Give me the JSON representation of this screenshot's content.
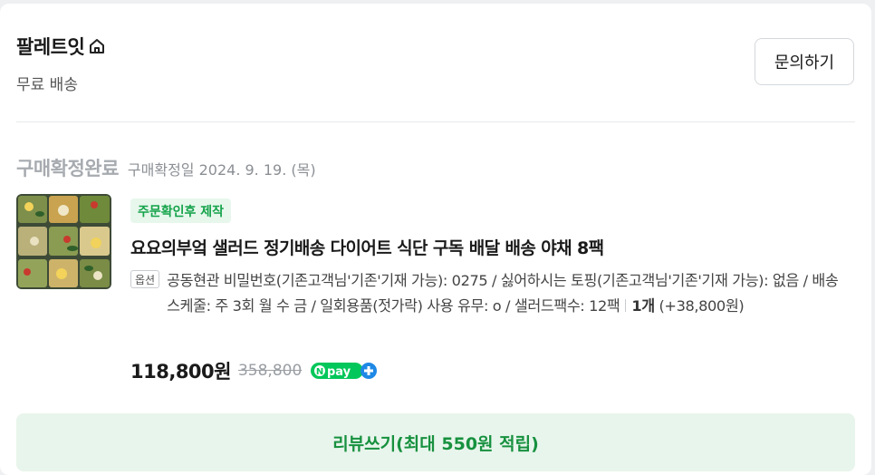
{
  "store": {
    "name": "팔레트잇",
    "shipping": "무료 배송",
    "inquiry_label": "문의하기"
  },
  "order": {
    "status": "구매확정완료",
    "confirm_date": "구매확정일 2024. 9. 19. (목)"
  },
  "product": {
    "badge": "주문확인후 제작",
    "name": "요요의부엌 샐러드 정기배송 다이어트 식단 구독 배달 배송 야채 8팩",
    "option_tag": "옵션",
    "option_text": "공동현관 비밀번호(기존고객님'기존'기재 가능): 0275 / 싫어하시는 토핑(기존고객님'기존'기재 가능): 없음 / 배송 스케줄: 주 3회 월 수 금 / 일회용품(젓가락) 사용 유무: o / 샐러드팩수: 12팩",
    "quantity": "1개",
    "extra_price": "(+38,800원)",
    "price": "118,800원",
    "original_price": "358,800",
    "npay_text": "pay"
  },
  "review": {
    "button_label": "리뷰쓰기(최대 550원 적립)"
  },
  "colors": {
    "accent_green": "#17913f",
    "badge_green": "#14a34a",
    "npay_green": "#03c75a",
    "npay_blue": "#1e88e5"
  }
}
